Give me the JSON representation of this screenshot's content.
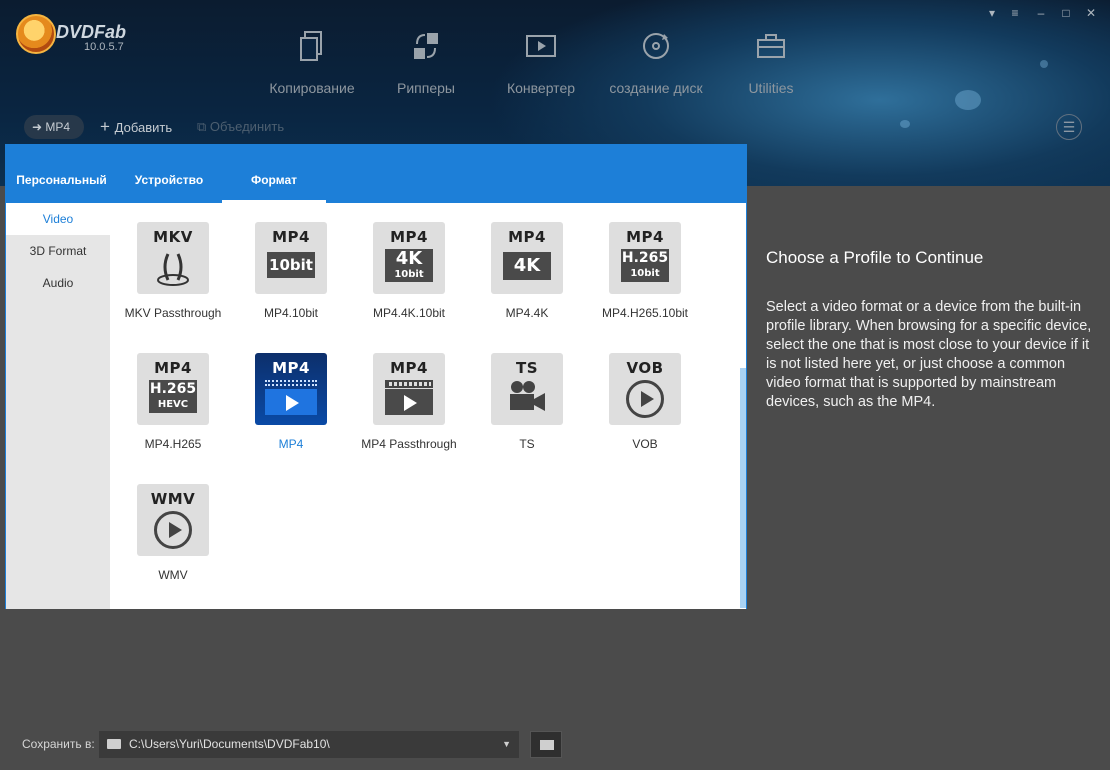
{
  "app": {
    "brand": "DVDFab",
    "version": "10.0.5.7"
  },
  "window": {
    "controls": [
      "pin-icon",
      "dropdown-icon",
      "minimize-icon",
      "maximize-icon",
      "close-icon"
    ]
  },
  "nav": [
    {
      "label": "Копирование",
      "icon": "copy-icon"
    },
    {
      "label": "Рипперы",
      "icon": "ripper-icon"
    },
    {
      "label": "Конвертер",
      "icon": "converter-icon"
    },
    {
      "label": "создание диск",
      "icon": "disc-icon"
    },
    {
      "label": "Utilities",
      "icon": "toolbox-icon"
    }
  ],
  "toolbar": {
    "profile": "MP4",
    "add": "Добавить",
    "merge": "Объединить"
  },
  "dialog": {
    "tabs": [
      "Персональный",
      "Устройство",
      "Формат"
    ],
    "active_tab": "Формат",
    "categories": [
      "Video",
      "3D Format",
      "Audio"
    ],
    "active_category": "Video",
    "formats": [
      {
        "name": "MKV Passthrough",
        "icon_title": "MKV"
      },
      {
        "name": "MP4.10bit",
        "icon_title": "MP4",
        "badge": "10bit"
      },
      {
        "name": "MP4.4K.10bit",
        "icon_title": "MP4",
        "badge": "4K",
        "badge2": "10bit"
      },
      {
        "name": "MP4.4K",
        "icon_title": "MP4",
        "badge": "4K"
      },
      {
        "name": "MP4.H265.10bit",
        "icon_title": "MP4",
        "badge": "H.265",
        "badge2": "10bit"
      },
      {
        "name": "MP4.H265",
        "icon_title": "MP4",
        "badge": "H.265",
        "badge2": "HEVC"
      },
      {
        "name": "MP4",
        "icon_title": "MP4",
        "selected": true
      },
      {
        "name": "MP4 Passthrough",
        "icon_title": "MP4"
      },
      {
        "name": "TS",
        "icon_title": "TS"
      },
      {
        "name": "VOB",
        "icon_title": "VOB"
      },
      {
        "name": "WMV",
        "icon_title": "WMV"
      }
    ]
  },
  "info": {
    "title": "Choose a Profile to Continue",
    "body": "Select a video format or a device from the built-in profile library. When browsing for a specific device, select the one that is most close to your device if it is not listed here yet, or just choose a common video format that is supported by mainstream devices, such as the MP4."
  },
  "footer": {
    "save_label": "Сохранить в:",
    "path": "C:\\Users\\Yuri\\Documents\\DVDFab10\\"
  },
  "colors": {
    "accent": "#1d7fd8",
    "selected_icon": "#0a4aa6"
  }
}
